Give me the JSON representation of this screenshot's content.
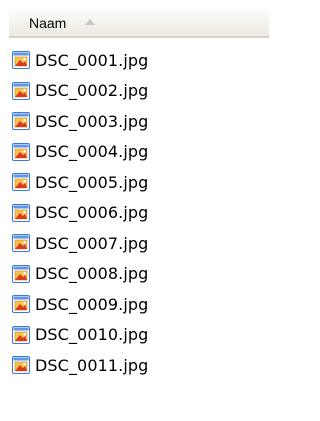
{
  "header": {
    "column_label": "Naam",
    "sort_icon": "sort-ascending-icon"
  },
  "files": [
    {
      "name": "DSC_0001.jpg",
      "icon": "jpg-file-icon"
    },
    {
      "name": "DSC_0002.jpg",
      "icon": "jpg-file-icon"
    },
    {
      "name": "DSC_0003.jpg",
      "icon": "jpg-file-icon"
    },
    {
      "name": "DSC_0004.jpg",
      "icon": "jpg-file-icon"
    },
    {
      "name": "DSC_0005.jpg",
      "icon": "jpg-file-icon"
    },
    {
      "name": "DSC_0006.jpg",
      "icon": "jpg-file-icon"
    },
    {
      "name": "DSC_0007.jpg",
      "icon": "jpg-file-icon"
    },
    {
      "name": "DSC_0008.jpg",
      "icon": "jpg-file-icon"
    },
    {
      "name": "DSC_0009.jpg",
      "icon": "jpg-file-icon"
    },
    {
      "name": "DSC_0010.jpg",
      "icon": "jpg-file-icon"
    },
    {
      "name": "DSC_0011.jpg",
      "icon": "jpg-file-icon"
    }
  ],
  "colors": {
    "header_bg_top": "#fbfbfa",
    "header_bg_bottom": "#eceae2",
    "header_border": "#d6d2c4",
    "sort_arrow": "#c9c6bb",
    "icon_frame": "#3a78d8",
    "icon_red": "#d83b1f"
  }
}
